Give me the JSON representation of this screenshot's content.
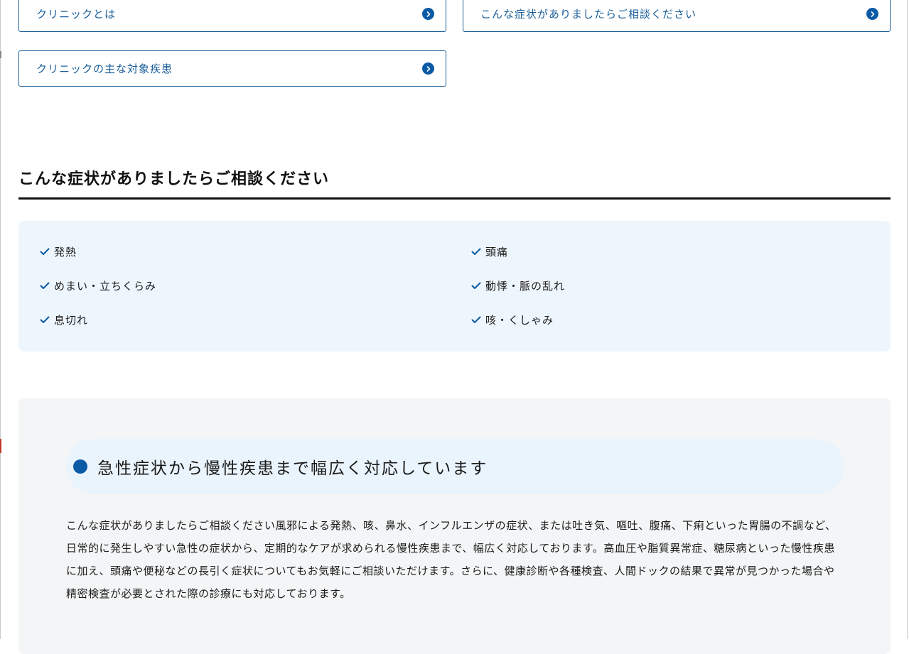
{
  "nav_links": [
    {
      "label": "クリニックとは"
    },
    {
      "label": "こんな症状がありましたらご相談ください"
    },
    {
      "label": "クリニックの主な対象疾患"
    }
  ],
  "symptoms_section": {
    "title": "こんな症状がありましたらご相談ください",
    "items": [
      "発熱",
      "頭痛",
      "めまい・立ちくらみ",
      "動悸・脈の乱れ",
      "息切れ",
      "咳・くしゃみ"
    ]
  },
  "info_section": {
    "heading": "急性症状から慢性疾患まで幅広く対応しています",
    "body": "こんな症状がありましたらご相談ください風邪による発熱、咳、鼻水、インフルエンザの症状、または吐き気、嘔吐、腹痛、下痢といった胃腸の不調など、日常的に発生しやすい急性の症状から、定期的なケアが求められる慢性疾患まで、幅広く対応しております。高血圧や脂質異常症、糖尿病といった慢性疾患に加え、頭痛や便秘などの長引く症状についてもお気軽にご相談いただけます。さらに、健康診断や各種検査、人間ドックの結果で異常が見つかった場合や精密検査が必要とされた際の診療にも対応しております。"
  },
  "colors": {
    "accent": "#0b5aa6",
    "link_text": "#1a5e9a",
    "symptom_bg": "#eef6fd",
    "info_bg": "#f4f5f6"
  }
}
